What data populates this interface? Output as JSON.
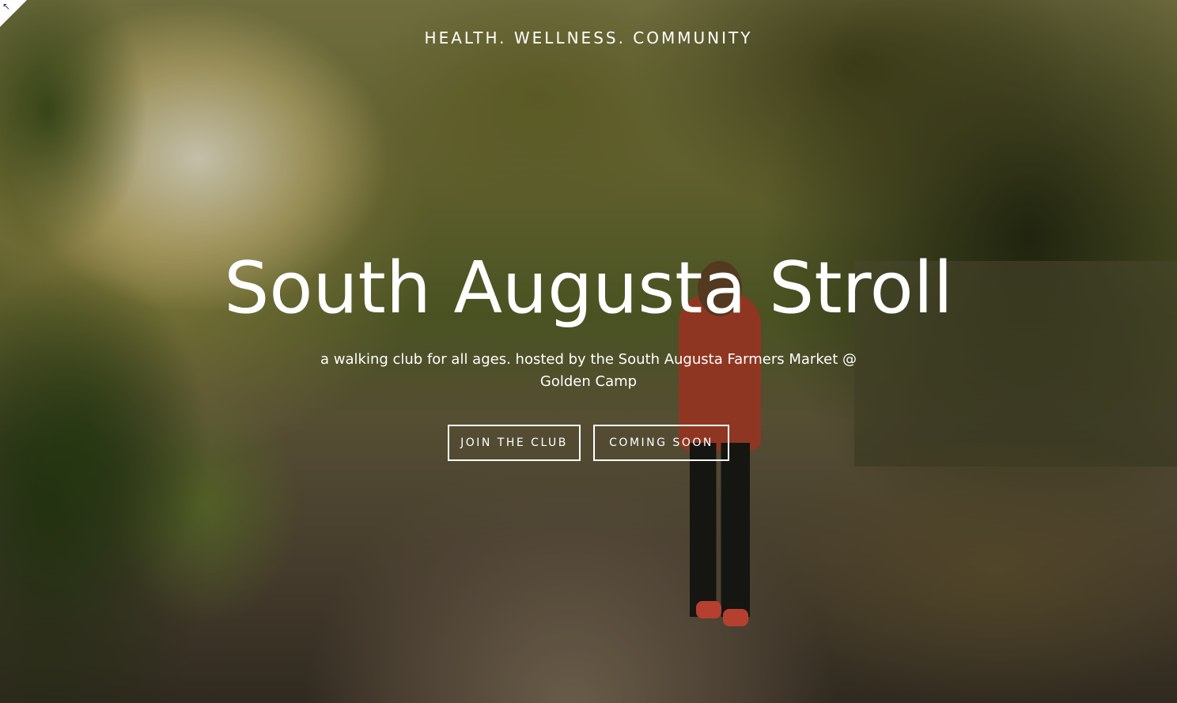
{
  "hero": {
    "tagline": "HEALTH. WELLNESS. COMMUNITY",
    "title": "South Augusta Stroll",
    "subtitle": "a walking club for all ages. hosted by the South Augusta Farmers Market @ Golden Camp",
    "buttons": {
      "join_label": "JOIN THE CLUB",
      "soon_label": "COMING SOON"
    },
    "background_image": "person-walking-on-tree-lined-path-at-sunset"
  },
  "corner": {
    "icon": "expand-arrow-icon",
    "glyph": "↖"
  },
  "colors": {
    "text": "#ffffff",
    "button_border": "#ffffff"
  }
}
